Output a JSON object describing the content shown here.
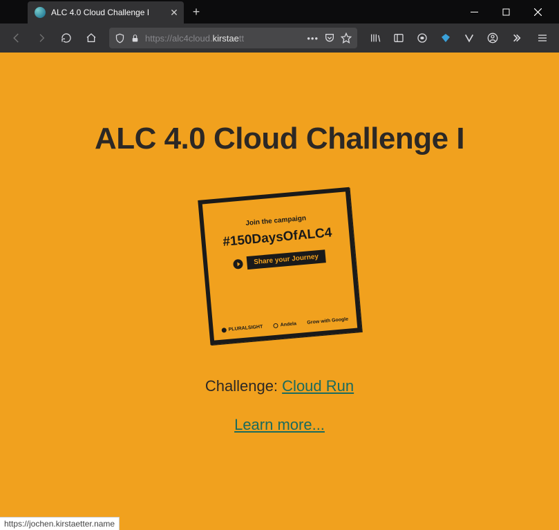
{
  "window": {
    "tab_title": "ALC 4.0 Cloud Challenge I",
    "url_protocol": "https://",
    "url_hostpre": "alc4cloud.",
    "url_hostmain": "kirstae",
    "url_hostrest": "tt"
  },
  "page": {
    "heading": "ALC 4.0 Cloud Challenge I",
    "poster": {
      "campaign": "Join the campaign",
      "hashtag": "#150DaysOfALC4",
      "share": "Share your Journey",
      "sponsor1": "PLURALSIGHT",
      "sponsor2": "Andela",
      "sponsor3": "Grow with Google"
    },
    "challenge_label": "Challenge: ",
    "challenge_link": "Cloud Run",
    "learn_more": "Learn more...",
    "status_url": "https://jochen.kirstaetter.name"
  }
}
